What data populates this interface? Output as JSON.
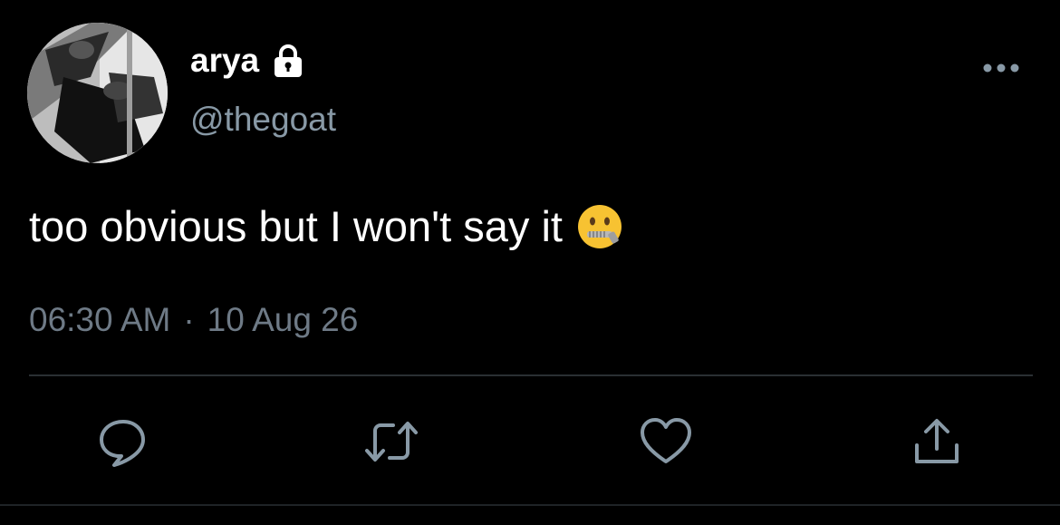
{
  "author": {
    "display_name": "arya",
    "handle": "@thegoat",
    "locked_icon": "lock-icon",
    "avatar_icon": "avatar-photo"
  },
  "tweet": {
    "text": "too obvious but I won't say it",
    "emoji_icon": "zipper-mouth-face-icon",
    "time": "06:30 AM",
    "separator": "·",
    "date": "10 Aug 26"
  },
  "actions": {
    "reply_icon": "reply-icon",
    "retweet_icon": "retweet-icon",
    "like_icon": "heart-icon",
    "share_icon": "share-icon",
    "more_icon": "more-icon"
  },
  "colors": {
    "background": "#000000",
    "primary_text": "#ffffff",
    "secondary_text": "#8899a6",
    "icon": "#8899a6",
    "divider": "#2a2f33"
  }
}
